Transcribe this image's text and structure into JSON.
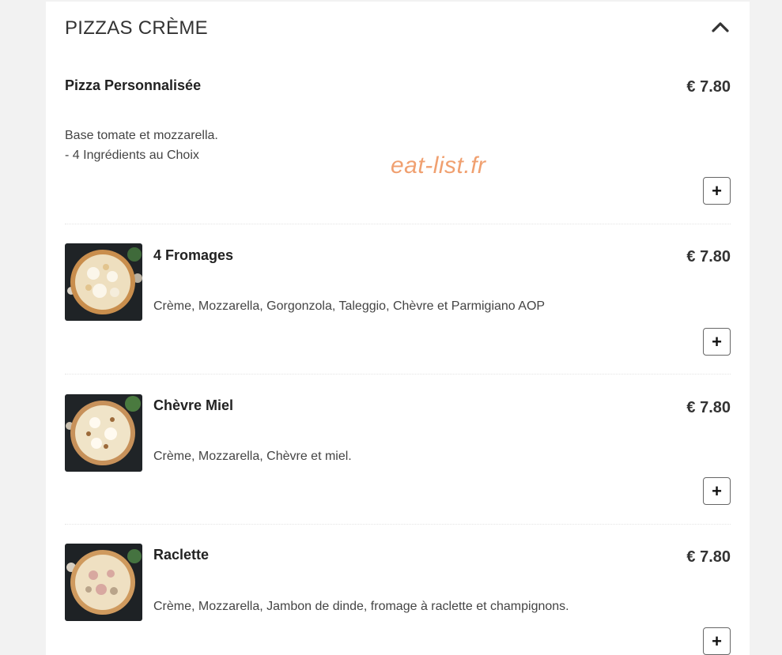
{
  "section": {
    "title": "PIZZAS CRÈME",
    "collapse_icon": "chevron-up-icon"
  },
  "watermark": "eat-list.fr",
  "items": [
    {
      "name": "Pizza Personnalisée",
      "price": "€ 7.80",
      "desc_lines": [
        "Base tomate et mozzarella.",
        "- 4 Ingrédients au Choix"
      ],
      "add_label": "+"
    },
    {
      "name": "4 Fromages",
      "price": "€ 7.80",
      "desc": "Crème, Mozzarella, Gorgonzola, Taleggio, Chèvre et Parmigiano AOP",
      "add_label": "+"
    },
    {
      "name": "Chèvre Miel",
      "price": "€ 7.80",
      "desc": "Crème, Mozzarella, Chèvre et miel.",
      "add_label": "+"
    },
    {
      "name": "Raclette",
      "price": "€ 7.80",
      "desc": "Crème, Mozzarella, Jambon de dinde, fromage à raclette et champignons.",
      "add_label": "+"
    }
  ]
}
